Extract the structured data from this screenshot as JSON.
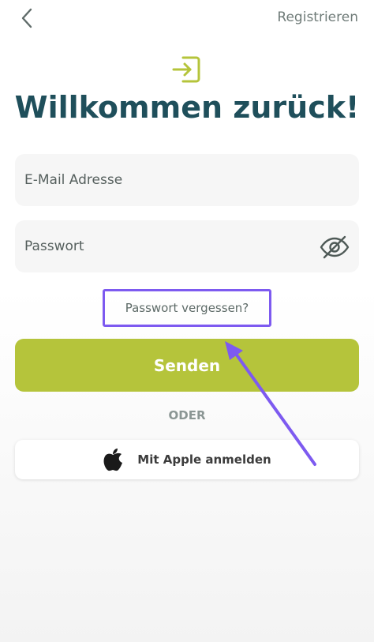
{
  "header": {
    "register_label": "Registrieren"
  },
  "icons": {
    "back": "chevron-left-icon",
    "login": "login-icon",
    "eye": "eye-off-icon",
    "apple": "apple-icon"
  },
  "title": "Willkommen zurück!",
  "form": {
    "email_placeholder": "E-Mail Adresse",
    "password_placeholder": "Passwort",
    "forgot_label": "Passwort vergessen?",
    "submit_label": "Senden",
    "divider_label": "ODER",
    "apple_label": "Mit Apple anmelden"
  },
  "colors": {
    "accent": "#b5c43b",
    "title": "#1f4f5b",
    "highlight": "#7d5af0"
  }
}
